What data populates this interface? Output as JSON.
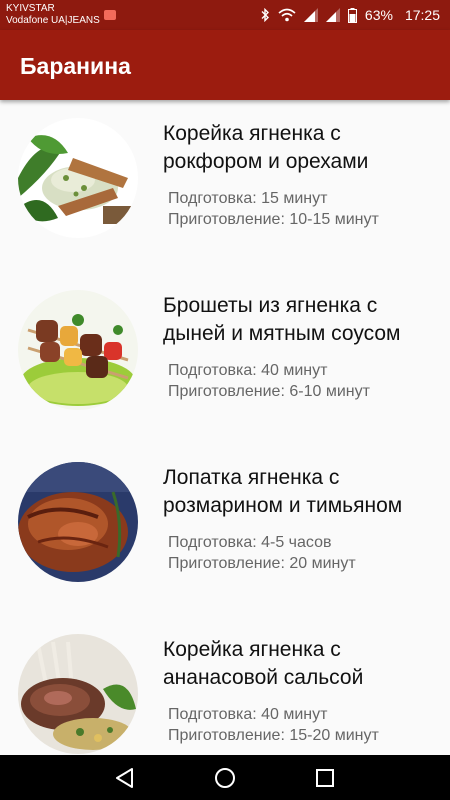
{
  "status_bar": {
    "carrier_1": "KYIVSTAR",
    "carrier_2": "Vodafone UA|JEANS",
    "battery": "63%",
    "time": "17:25",
    "icons": [
      "sim-notification-icon",
      "bluetooth-icon",
      "wifi-icon",
      "signal-icon",
      "signal-icon",
      "battery-icon"
    ]
  },
  "app_bar": {
    "title": "Баранина",
    "color": "#9c1c0f"
  },
  "recipes": [
    {
      "title": "Корейка ягненка с рокфором и орехами",
      "prep": "Подготовка: 15 минут",
      "cook": "Приготовление: 10-15 минут"
    },
    {
      "title": "Брошеты из ягненка с дыней и мятным соусом",
      "prep": "Подготовка: 40 минут",
      "cook": "Приготовление: 6-10 минут"
    },
    {
      "title": "Лопатка ягненка с розмарином и тимьяном",
      "prep": "Подготовка: 4-5 часов",
      "cook": "Приготовление: 20 минут"
    },
    {
      "title": "Корейка ягненка с ананасовой сальсой",
      "prep": "Подготовка: 40 минут",
      "cook": "Приготовление: 15-20 минут"
    }
  ],
  "nav_bar": {
    "icons": [
      "back-icon",
      "home-icon",
      "recents-icon"
    ]
  }
}
